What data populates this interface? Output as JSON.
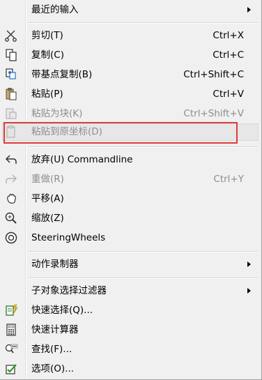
{
  "menu": {
    "recent": {
      "label": "最近的输入",
      "submenu": true
    },
    "cut": {
      "label": "剪切(T)",
      "shortcut": "Ctrl+X",
      "icon": "scissors-icon"
    },
    "copy": {
      "label": "复制(C)",
      "shortcut": "Ctrl+C",
      "icon": "copy-icon"
    },
    "copy_base": {
      "label": "带基点复制(B)",
      "shortcut": "Ctrl+Shift+C",
      "icon": "copy-with-basepoint-icon"
    },
    "paste": {
      "label": "粘贴(P)",
      "shortcut": "Ctrl+V",
      "icon": "paste-icon"
    },
    "paste_block": {
      "label": "粘贴为块(K)",
      "shortcut": "Ctrl+Shift+V",
      "icon": "paste-as-block-icon",
      "disabled": true
    },
    "paste_orig": {
      "label": "粘贴到原坐标(D)",
      "icon": "paste-to-original-icon",
      "disabled": true,
      "highlighted": true
    },
    "undo": {
      "label": "放弃(U) Commandline",
      "icon": "undo-icon"
    },
    "redo": {
      "label": "重做(R)",
      "shortcut": "Ctrl+Y",
      "icon": "redo-icon",
      "disabled": true
    },
    "pan": {
      "label": "平移(A)",
      "icon": "pan-hand-icon"
    },
    "zoom": {
      "label": "缩放(Z)",
      "icon": "zoom-icon"
    },
    "steering": {
      "label": "SteeringWheels",
      "icon": "steering-wheel-icon"
    },
    "recorder": {
      "label": "动作录制器",
      "submenu": true
    },
    "subobj": {
      "label": "子对象选择过滤器",
      "submenu": true
    },
    "quick_select": {
      "label": "快速选择(Q)...",
      "icon": "quick-select-icon"
    },
    "calc": {
      "label": "快速计算器",
      "icon": "calculator-icon"
    },
    "find": {
      "label": "查找(F)...",
      "icon": "find-abc-icon"
    },
    "options": {
      "label": "选项(O)...",
      "icon": "options-checkbox-icon"
    }
  },
  "colors": {
    "menu_bg": "#f0f0f0",
    "disabled_text": "#8d8d8d",
    "annotation": "#e0393a"
  }
}
